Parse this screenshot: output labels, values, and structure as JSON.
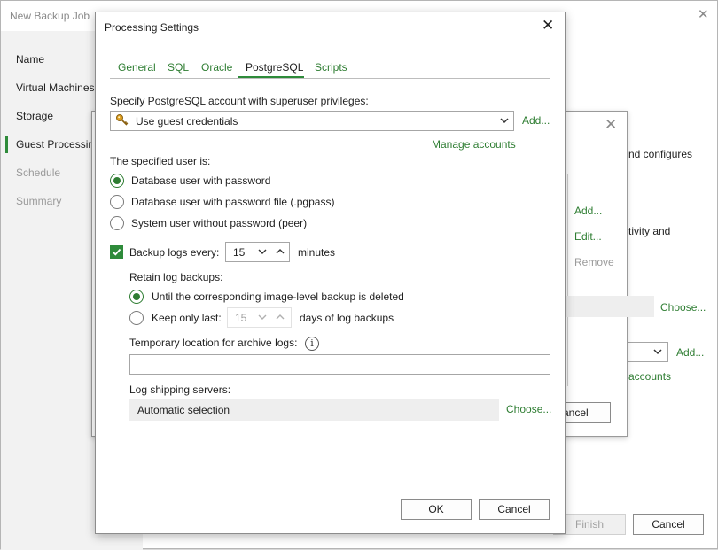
{
  "wizard": {
    "title": "New Backup Job",
    "nav": [
      "Name",
      "Virtual Machines",
      "Storage",
      "Guest Processing",
      "Schedule",
      "Summary"
    ],
    "fragments": {
      "configures": "nd configures",
      "activity": "tivity and",
      "add": "Add...",
      "edit": "Edit...",
      "remove": "Remove",
      "choose": "Choose...",
      "add2": "Add...",
      "accounts": "accounts",
      "cancel_mid": "ancel"
    },
    "buttons": {
      "finish": "Finish",
      "cancel": "Cancel"
    }
  },
  "dialog": {
    "title": "Processing Settings",
    "tabs": [
      "General",
      "SQL",
      "Oracle",
      "PostgreSQL",
      "Scripts"
    ],
    "active_tab": "PostgreSQL",
    "account_label": "Specify PostgreSQL account with superuser privileges:",
    "account_value": "Use guest credentials",
    "add_link": "Add...",
    "manage_link": "Manage accounts",
    "user_label": "The specified user is:",
    "user_options": [
      "Database user with password",
      "Database user with password file (.pgpass)",
      "System user without password (peer)"
    ],
    "selected_user_option": 0,
    "backup_logs_label": "Backup logs every:",
    "backup_logs_checked": true,
    "backup_logs_value": "15",
    "minutes": "minutes",
    "retain_label": "Retain log backups:",
    "retain_options": [
      "Until the corresponding image-level backup is deleted",
      "Keep only last:"
    ],
    "keep_value": "15",
    "days_label": "days of log backups",
    "temp_label": "Temporary location for archive logs:",
    "temp_value": "",
    "shipping_label": "Log shipping servers:",
    "shipping_value": "Automatic selection",
    "choose_link": "Choose...",
    "ok": "OK",
    "cancel": "Cancel"
  }
}
